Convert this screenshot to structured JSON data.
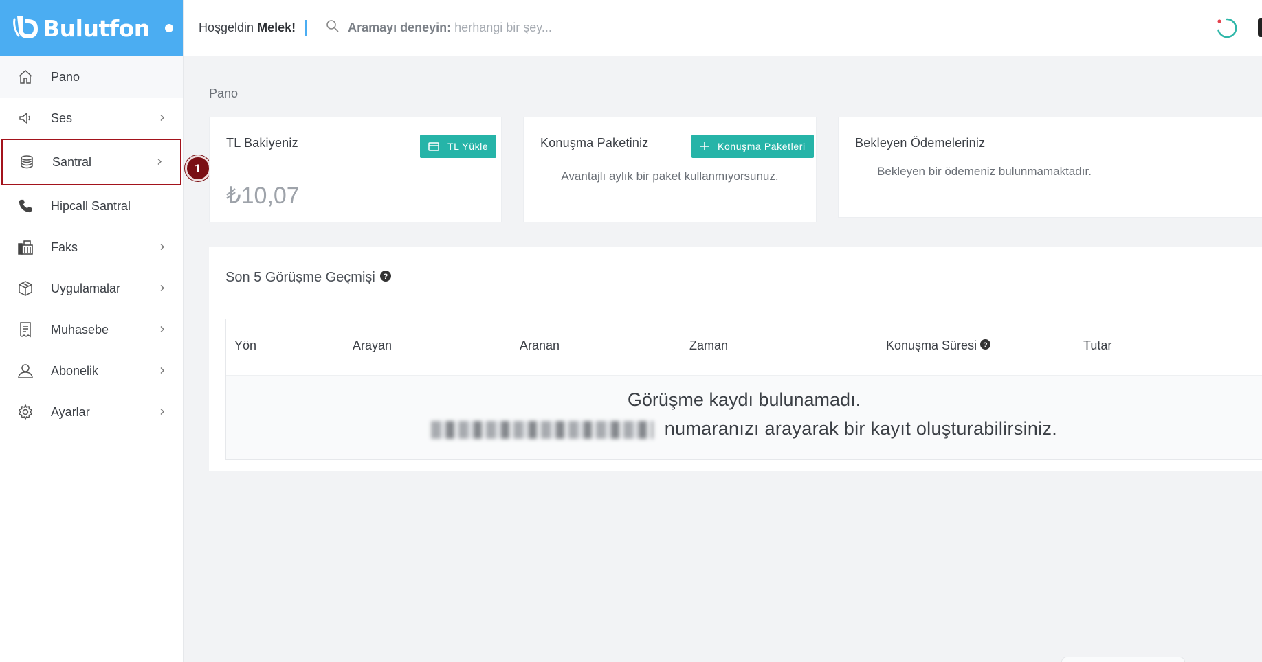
{
  "brand": {
    "name": "Bulutfon",
    "logo_icon": "bulutfon-phone-logo"
  },
  "sidebar": {
    "items": [
      {
        "label": "Pano",
        "icon": "home-icon",
        "chevron": false
      },
      {
        "label": "Ses",
        "icon": "speaker-icon",
        "chevron": true
      },
      {
        "label": "Santral",
        "icon": "database-icon",
        "chevron": true,
        "highlighted": true
      },
      {
        "label": "Hipcall Santral",
        "icon": "phone-icon",
        "chevron": false
      },
      {
        "label": "Faks",
        "icon": "fax-icon",
        "chevron": true
      },
      {
        "label": "Uygulamalar",
        "icon": "box-icon",
        "chevron": true
      },
      {
        "label": "Muhasebe",
        "icon": "receipt-icon",
        "chevron": true
      },
      {
        "label": "Abonelik",
        "icon": "user-icon",
        "chevron": true
      },
      {
        "label": "Ayarlar",
        "icon": "gear-icon",
        "chevron": true
      }
    ]
  },
  "annotation": {
    "step": "1"
  },
  "topbar": {
    "welcome_prefix": "Hoşgeldin",
    "user_name": "Melek!",
    "search_try": "Aramayı deneyin:",
    "search_placeholder": "herhangi bir şey..."
  },
  "page": {
    "breadcrumb": "Pano"
  },
  "cards": {
    "balance": {
      "title": "TL Bakiyeniz",
      "button": "TL Yükle",
      "amount": "₺10,07"
    },
    "package": {
      "title": "Konuşma Paketiniz",
      "button": "Konuşma Paketleri",
      "text": "Avantajlı aylık bir paket kullanmıyorsunuz."
    },
    "payments": {
      "title": "Bekleyen Ödemeleriniz",
      "text": "Bekleyen bir ödemeniz bulunmamaktadır."
    }
  },
  "history": {
    "title": "Son 5 Görüşme Geçmişi",
    "columns": [
      "Yön",
      "Arayan",
      "Aranan",
      "Zaman",
      "Konuşma Süresi",
      "Tutar"
    ],
    "empty_line1": "Görüşme kaydı bulunamadı.",
    "empty_line2": "numaranızı arayarak bir kayıt oluşturabilirsiniz."
  },
  "colors": {
    "brand_blue": "#4badf2",
    "teal": "#26b4a8",
    "highlight_red": "#a3131c"
  }
}
